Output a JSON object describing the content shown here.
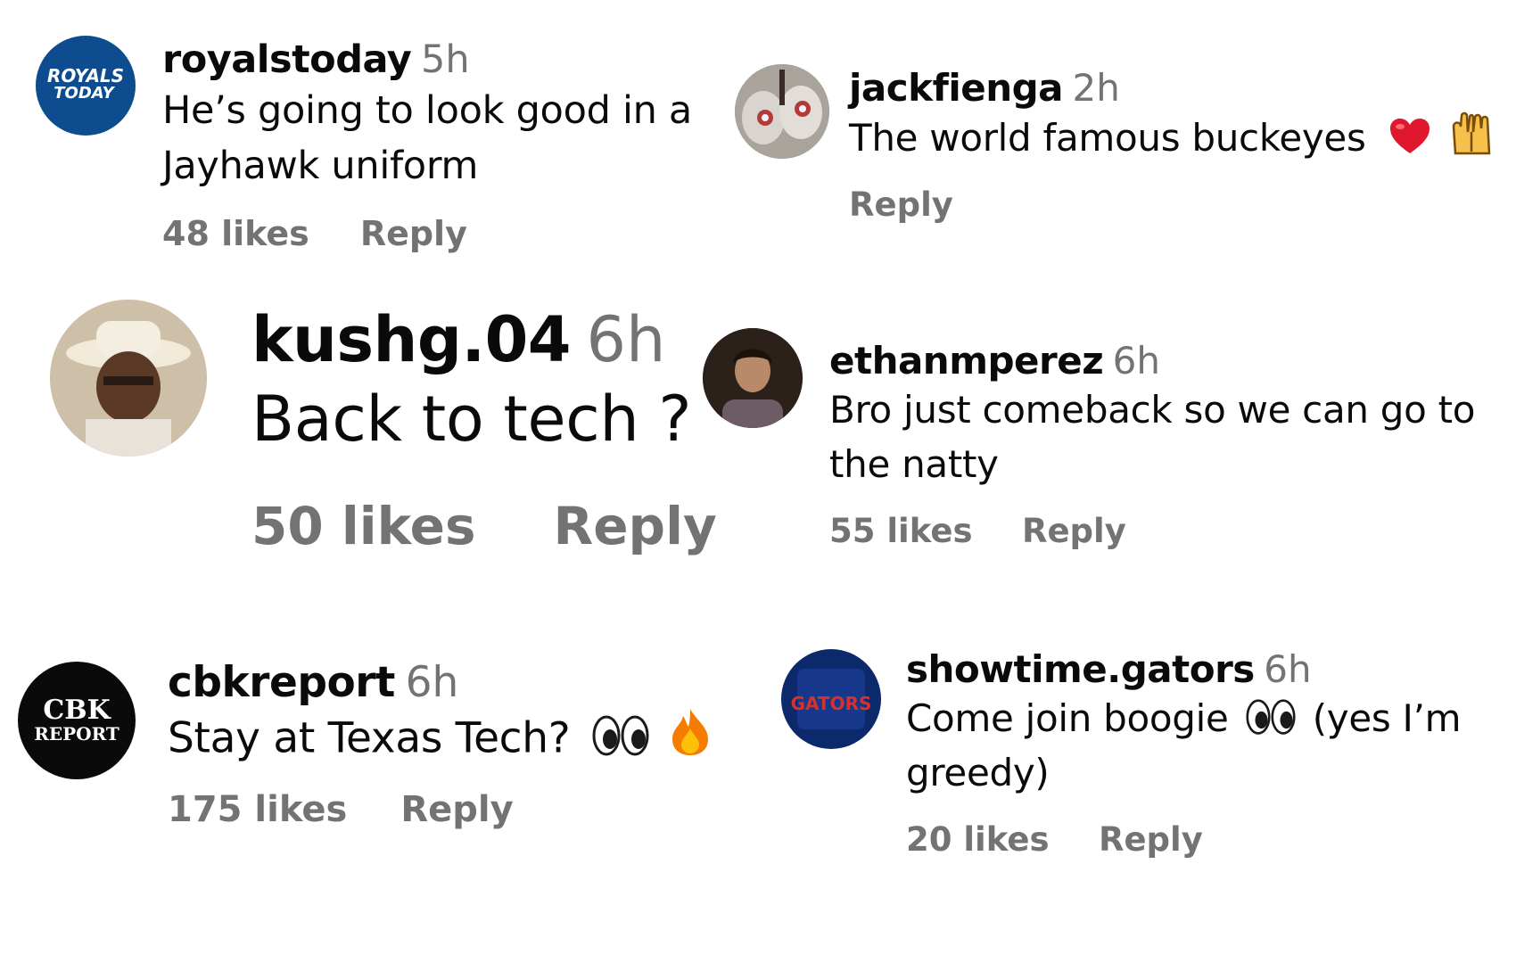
{
  "comments": [
    {
      "username": "royalstoday",
      "time": "5h",
      "text_line1": "He’s going to look good in a",
      "text_line2": "Jayhawk uniform",
      "likes": "48 likes",
      "reply": "Reply",
      "avatar": {
        "label_top": "ROYALS",
        "label_bottom": "TODAY",
        "bg": "#0d4c8f",
        "fg": "#ffffff"
      }
    },
    {
      "username": "jackfienga",
      "time": "2h",
      "text": "The world famous buckeyes",
      "emoji": [
        "red-heart",
        "raised-hands"
      ],
      "reply": "Reply"
    },
    {
      "username": "kushg.04",
      "time": "6h",
      "text": "Back to tech ?",
      "likes": "50 likes",
      "reply": "Reply"
    },
    {
      "username": "ethanmperez",
      "time": "6h",
      "text_line1": "Bro just comeback so we can go to",
      "text_line2": "the natty",
      "likes": "55 likes",
      "reply": "Reply"
    },
    {
      "username": "cbkreport",
      "time": "6h",
      "text": "Stay at Texas Tech?",
      "emoji": [
        "eyes",
        "fire"
      ],
      "likes": "175 likes",
      "reply": "Reply",
      "avatar": {
        "label_top": "CBK",
        "label_bottom": "REPORT",
        "bg": "#0a0a0a",
        "fg": "#ffffff"
      }
    },
    {
      "username": "showtime.gators",
      "time": "6h",
      "text_line1_before": "Come join boogie",
      "text_line1_after": "(yes I’m",
      "emoji": [
        "eyes"
      ],
      "text_line2": "greedy)",
      "likes": "20 likes",
      "reply": "Reply",
      "avatar": {
        "label": "GATORS",
        "bg": "#0c2a6b",
        "fg": "#d4322c"
      }
    }
  ],
  "colors": {
    "text": "#0a0a0a",
    "meta": "#737373",
    "background": "#ffffff"
  }
}
